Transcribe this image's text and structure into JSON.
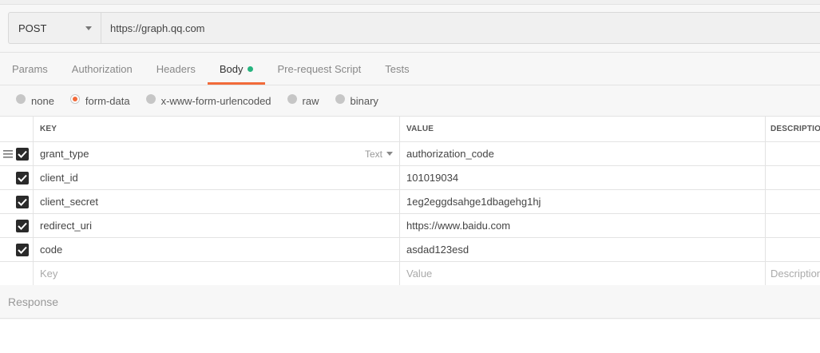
{
  "request": {
    "method": "POST",
    "url": "https://graph.qq.com"
  },
  "tabs": [
    {
      "label": "Params"
    },
    {
      "label": "Authorization"
    },
    {
      "label": "Headers"
    },
    {
      "label": "Body"
    },
    {
      "label": "Pre-request Script"
    },
    {
      "label": "Tests"
    }
  ],
  "active_tab": "Body",
  "body_modes": [
    {
      "label": "none",
      "selected": false
    },
    {
      "label": "form-data",
      "selected": true
    },
    {
      "label": "x-www-form-urlencoded",
      "selected": false
    },
    {
      "label": "raw",
      "selected": false
    },
    {
      "label": "binary",
      "selected": false
    }
  ],
  "table": {
    "headers": {
      "key": "KEY",
      "value": "VALUE",
      "description": "DESCRIPTION"
    },
    "rows": [
      {
        "key": "grant_type",
        "value": "authorization_code",
        "checked": true,
        "type": "Text"
      },
      {
        "key": "client_id",
        "value": "101019034",
        "checked": true
      },
      {
        "key": "client_secret",
        "value": "1eg2eggdsahge1dbagehg1hj",
        "checked": true
      },
      {
        "key": "redirect_uri",
        "value": "https://www.baidu.com",
        "checked": true
      },
      {
        "key": "code",
        "value": "asdad123esd",
        "checked": true
      }
    ],
    "placeholders": {
      "key": "Key",
      "value": "Value",
      "description": "Description"
    }
  },
  "response": {
    "label": "Response"
  },
  "colors": {
    "accent": "#f26b3a",
    "body_dot": "#26b47f",
    "checkbox": "#2a2a2a"
  }
}
